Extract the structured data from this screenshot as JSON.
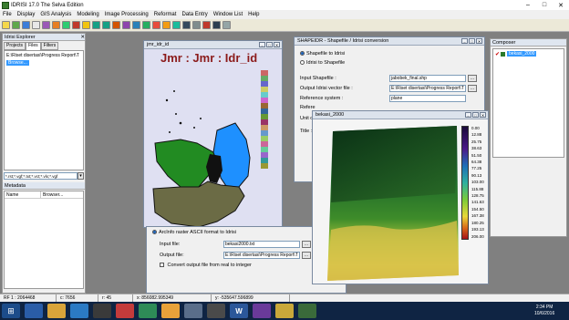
{
  "window": {
    "title": "IDRISI 17.0   The Selva Edition"
  },
  "menu": [
    "File",
    "Display",
    "GIS Analysis",
    "Modeling",
    "Image Processing",
    "Reformat",
    "Data Entry",
    "Window List",
    "Help"
  ],
  "explorer": {
    "title": "Idrisi Explorer",
    "tabs": [
      "Projects",
      "Files",
      "Filters"
    ],
    "path": "E:\\Riset disertasi\\Progress Report\\T",
    "browse_label": "Browse...",
    "filter_text": "*.rst;*.vgf;*.txt;*.vct;*.vlx;*.vgf",
    "metadata_title": "Metadata",
    "meta_name_label": "Name",
    "meta_name_value": "Browser..."
  },
  "map_window": {
    "title": "jmr_idr_id",
    "map_title": "Jmr : Jmr : Idr_id"
  },
  "shapeidr": {
    "title": "SHAPEIDR - Shapefile / Idrisi conversion",
    "opt1": "Shapefile to Idrisi",
    "opt2": "Idrisi to Shapefile",
    "input_label": "Input Shapefile :",
    "input_value": "jabobek_final.shp",
    "output_label": "Output Idrisi vector file :",
    "output_value": "E:\\Riset disertasi\\Progress Report\\T",
    "ref_label": "Reference system :",
    "ref_value": "plane",
    "ref2_label": "Refere",
    "unit_label": "Unit o",
    "title_label": "Title :",
    "browse": "..."
  },
  "arcinfo": {
    "radio_label": "ArcInfo raster ASCII format to Idrisi",
    "input_label": "Input file:",
    "input_value": "bekasi2000.txt",
    "output_label": "Output file:",
    "output_value": "E:\\Riset disertasi\\Progress Report\\T",
    "checkbox_label": "Convert output file from real to integer",
    "browse": "..."
  },
  "bekasi": {
    "title": "bekasi_2000",
    "legend": [
      "0.00",
      "12.88",
      "25.75",
      "38.63",
      "51.50",
      "64.38",
      "77.25",
      "90.13",
      "103.00",
      "115.88",
      "128.75",
      "141.63",
      "154.50",
      "167.38",
      "180.25",
      "193.13",
      "206.00"
    ]
  },
  "composer": {
    "title": "Composer",
    "layer": "bekasi_2000"
  },
  "status": {
    "rf": "RF 1 : 2064468",
    "c": "c: 7656",
    "r": "r: 45",
    "x": "x: 856082.995349",
    "y": "y: -535647.596899"
  },
  "clock": {
    "time": "2:34 PM",
    "date": "10/6/2016"
  }
}
